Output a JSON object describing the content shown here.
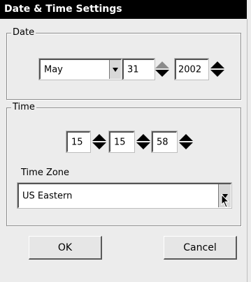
{
  "window": {
    "title": "Date & Time Settings"
  },
  "date": {
    "legend": "Date",
    "month": "May",
    "day": "31",
    "year": "2002"
  },
  "time": {
    "legend": "Time",
    "hour": "15",
    "minute": "15",
    "second": "58",
    "timezone_label": "Time Zone",
    "timezone_value": "US Eastern"
  },
  "buttons": {
    "ok": "OK",
    "cancel": "Cancel"
  },
  "icons": {
    "dropdown": "chevron-down-icon",
    "spin": "spin-arrows-icon",
    "cursor": "mouse-pointer-icon"
  }
}
